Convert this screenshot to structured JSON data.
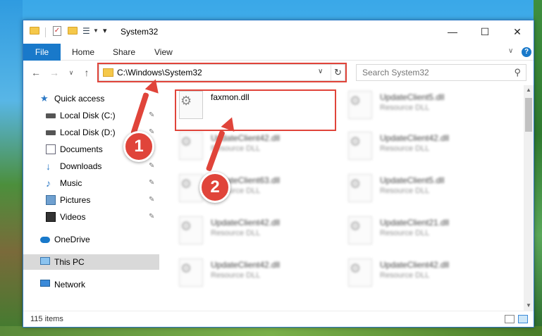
{
  "window": {
    "title": "System32",
    "minimize": "—",
    "maximize": "☐",
    "close": "✕"
  },
  "ribbon": {
    "file": "File",
    "home": "Home",
    "share": "Share",
    "view": "View"
  },
  "address": {
    "path": "C:\\Windows\\System32"
  },
  "search": {
    "placeholder": "Search System32"
  },
  "sidebar": {
    "items": [
      {
        "label": "Quick access",
        "icon": "star-icon"
      },
      {
        "label": "Local Disk (C:)",
        "icon": "drive-icon",
        "pinned": true
      },
      {
        "label": "Local Disk (D:)",
        "icon": "drive-icon",
        "pinned": true
      },
      {
        "label": "Documents",
        "icon": "documents-icon",
        "pinned": true
      },
      {
        "label": "Downloads",
        "icon": "downloads-icon",
        "pinned": true
      },
      {
        "label": "Music",
        "icon": "music-icon",
        "pinned": true
      },
      {
        "label": "Pictures",
        "icon": "pictures-icon",
        "pinned": true
      },
      {
        "label": "Videos",
        "icon": "videos-icon",
        "pinned": true
      },
      {
        "label": "OneDrive",
        "icon": "onedrive-icon"
      },
      {
        "label": "This PC",
        "icon": "pc-icon",
        "selected": true
      },
      {
        "label": "Network",
        "icon": "network-icon"
      }
    ]
  },
  "files": [
    {
      "name": "faxmon.dll",
      "type": ""
    },
    {
      "name": "UpdateClient5.dll",
      "type": "Resource DLL"
    },
    {
      "name": "UpdateClient42.dll",
      "type": "Resource DLL"
    },
    {
      "name": "UpdateClient42.dll",
      "type": "Resource DLL"
    },
    {
      "name": "UpdateClient63.dll",
      "type": "Resource DLL"
    },
    {
      "name": "UpdateClient5.dll",
      "type": "Resource DLL"
    },
    {
      "name": "UpdateClient42.dll",
      "type": "Resource DLL"
    },
    {
      "name": "UpdateClient21.dll",
      "type": "Resource DLL"
    },
    {
      "name": "UpdateClient42.dll",
      "type": "Resource DLL"
    },
    {
      "name": "UpdateClient42.dll",
      "type": "Resource DLL"
    }
  ],
  "status": {
    "count": "115 items"
  },
  "annotations": {
    "step1": "1",
    "step2": "2",
    "color": "#e0443a"
  },
  "colors": {
    "accent": "#1979ca",
    "selection": "#d9d9d9"
  }
}
